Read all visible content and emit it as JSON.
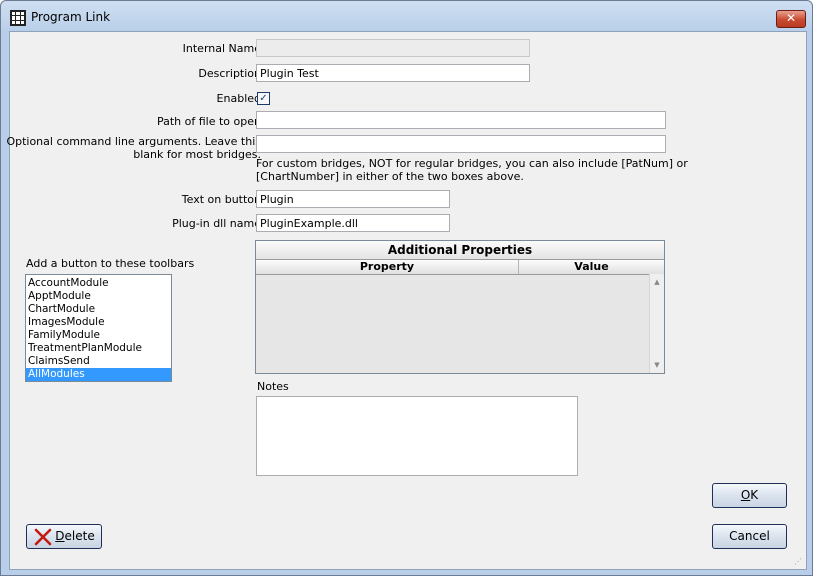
{
  "window": {
    "title": "Program Link",
    "close_label": "✕"
  },
  "form": {
    "internal_name": {
      "label": "Internal Name",
      "value": ""
    },
    "description": {
      "label": "Description",
      "value": "Plugin Test"
    },
    "enabled": {
      "label": "Enabled",
      "checked": true,
      "mark": "✓"
    },
    "path": {
      "label": "Path of file to open",
      "value": ""
    },
    "args": {
      "label_line1": "Optional command line arguments.  Leave this",
      "label_line2": "blank for most bridges.",
      "value": ""
    },
    "hint": {
      "line1": "For custom bridges, NOT for regular bridges, you can also include [PatNum] or",
      "line2": "[ChartNumber] in either of the two boxes above."
    },
    "button_text": {
      "label": "Text on button",
      "value": "Plugin"
    },
    "dll_name": {
      "label": "Plug-in dll name",
      "value": "PluginExample.dll"
    }
  },
  "toolbars": {
    "label": "Add a button to these toolbars",
    "items": [
      {
        "label": "AccountModule",
        "selected": false
      },
      {
        "label": "ApptModule",
        "selected": false
      },
      {
        "label": "ChartModule",
        "selected": false
      },
      {
        "label": "ImagesModule",
        "selected": false
      },
      {
        "label": "FamilyModule",
        "selected": false
      },
      {
        "label": "TreatmentPlanModule",
        "selected": false
      },
      {
        "label": "ClaimsSend",
        "selected": false
      },
      {
        "label": "AllModules",
        "selected": true
      }
    ]
  },
  "properties": {
    "title": "Additional Properties",
    "columns": [
      "Property",
      "Value"
    ],
    "rows": []
  },
  "notes": {
    "label": "Notes",
    "value": ""
  },
  "buttons": {
    "ok": {
      "label": "OK",
      "mnemonic": "O",
      "rest": "K"
    },
    "cancel": {
      "label": "Cancel"
    },
    "delete": {
      "label": "Delete",
      "mnemonic": "D",
      "rest": "elete"
    }
  },
  "colors": {
    "selection": "#3399ff",
    "close_button": "#c74a31"
  }
}
